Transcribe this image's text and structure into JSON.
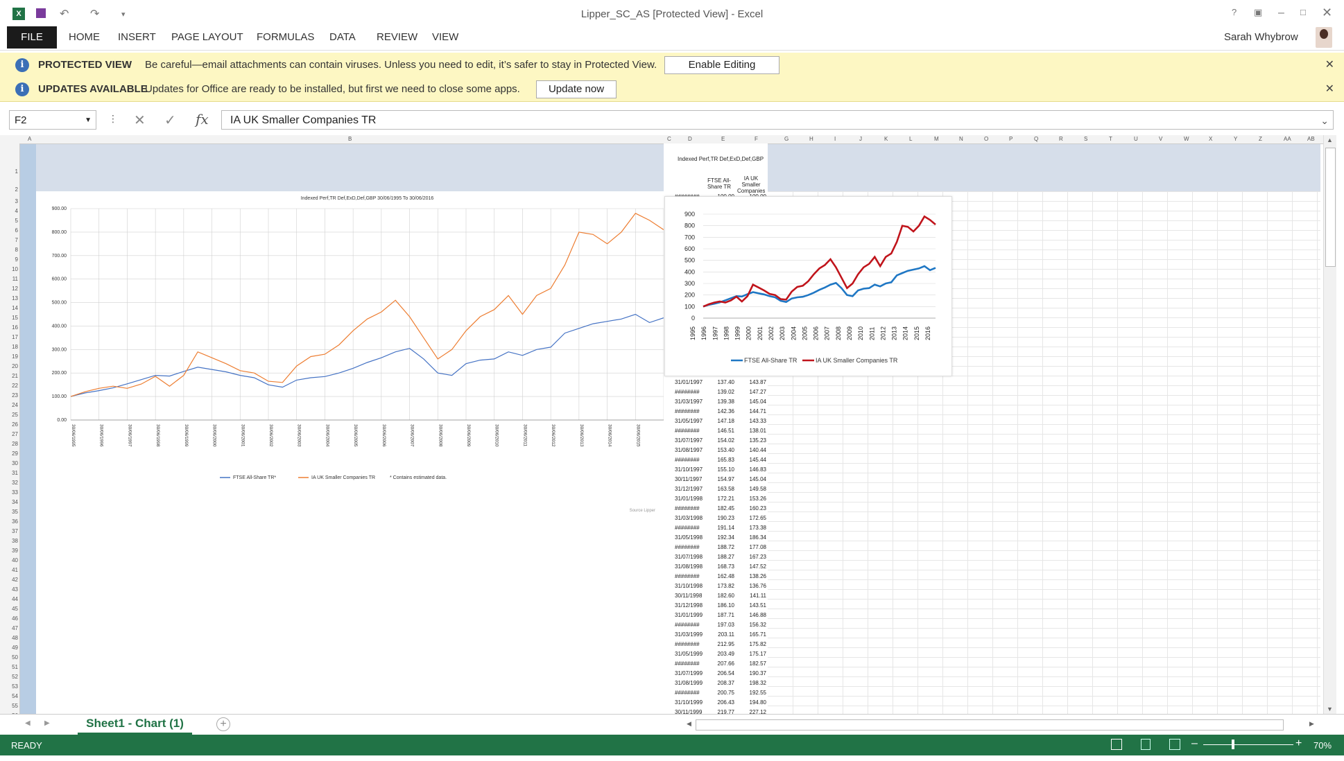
{
  "window": {
    "title": "Lipper_SC_AS  [Protected View] - Excel",
    "user": "Sarah Whybrow"
  },
  "ribbon": {
    "tabs": [
      "FILE",
      "HOME",
      "INSERT",
      "PAGE LAYOUT",
      "FORMULAS",
      "DATA",
      "REVIEW",
      "VIEW"
    ]
  },
  "protected_bar": {
    "title": "PROTECTED VIEW",
    "text": "Be careful—email attachments can contain viruses. Unless you need to edit, it’s safer to stay in Protected View.",
    "button": "Enable Editing"
  },
  "updates_bar": {
    "title": "UPDATES AVAILABLE",
    "text": "Updates for Office are ready to be installed, but first we need to close some apps.",
    "button": "Update now"
  },
  "formula_bar": {
    "name_box": "F2",
    "formula": "IA UK Smaller Companies TR"
  },
  "columns": [
    "A",
    "B",
    "C",
    "D",
    "E",
    "F",
    "G",
    "H",
    "I",
    "J",
    "K",
    "L",
    "M",
    "N",
    "O",
    "P",
    "Q",
    "R",
    "S",
    "T",
    "U",
    "V",
    "W",
    "X",
    "Y",
    "Z",
    "AA",
    "AB"
  ],
  "rows": [
    "1",
    "2",
    "3",
    "4",
    "5",
    "6",
    "7",
    "8",
    "9",
    "10",
    "11",
    "12",
    "13",
    "14",
    "15",
    "16",
    "17",
    "18",
    "19",
    "20",
    "21",
    "22",
    "23",
    "24",
    "25",
    "26",
    "27",
    "28",
    "29",
    "30",
    "31",
    "32",
    "33",
    "34",
    "35",
    "36",
    "37",
    "38",
    "39",
    "40",
    "41",
    "42",
    "43",
    "44",
    "45",
    "46",
    "47",
    "48",
    "49",
    "50",
    "51",
    "52",
    "53",
    "54",
    "55",
    "56"
  ],
  "table": {
    "heading": "Indexed Perf,TR Def,ExD,Def,GBP",
    "col_e": "FTSE All-Share TR",
    "col_f": "IA UK Smaller Companies",
    "first_row": {
      "date": "########",
      "e": "100.00",
      "f": "100.00"
    },
    "rows": [
      [
        "31/01/1997",
        "137.40",
        "143.87"
      ],
      [
        "########",
        "139.02",
        "147.27"
      ],
      [
        "31/03/1997",
        "139.38",
        "145.04"
      ],
      [
        "########",
        "142.36",
        "144.71"
      ],
      [
        "31/05/1997",
        "147.18",
        "143.33"
      ],
      [
        "########",
        "146.51",
        "138.01"
      ],
      [
        "31/07/1997",
        "154.02",
        "135.23"
      ],
      [
        "31/08/1997",
        "153.40",
        "140.44"
      ],
      [
        "########",
        "165.83",
        "145.44"
      ],
      [
        "31/10/1997",
        "155.10",
        "146.83"
      ],
      [
        "30/11/1997",
        "154.97",
        "145.04"
      ],
      [
        "31/12/1997",
        "163.58",
        "149.58"
      ],
      [
        "31/01/1998",
        "172.21",
        "153.26"
      ],
      [
        "########",
        "182.45",
        "160.23"
      ],
      [
        "31/03/1998",
        "190.23",
        "172.65"
      ],
      [
        "########",
        "191.14",
        "173.38"
      ],
      [
        "31/05/1998",
        "192.34",
        "186.34"
      ],
      [
        "########",
        "188.72",
        "177.08"
      ],
      [
        "31/07/1998",
        "188.27",
        "167.23"
      ],
      [
        "31/08/1998",
        "168.73",
        "147.52"
      ],
      [
        "########",
        "162.48",
        "138.26"
      ],
      [
        "31/10/1998",
        "173.82",
        "136.76"
      ],
      [
        "30/11/1998",
        "182.60",
        "141.11"
      ],
      [
        "31/12/1998",
        "186.10",
        "143.51"
      ],
      [
        "31/01/1999",
        "187.71",
        "146.88"
      ],
      [
        "########",
        "197.03",
        "156.32"
      ],
      [
        "31/03/1999",
        "203.11",
        "165.71"
      ],
      [
        "########",
        "212.95",
        "175.82"
      ],
      [
        "31/05/1999",
        "203.49",
        "175.17"
      ],
      [
        "########",
        "207.66",
        "182.57"
      ],
      [
        "31/07/1999",
        "206.54",
        "190.37"
      ],
      [
        "31/08/1999",
        "208.37",
        "198.32"
      ],
      [
        "########",
        "200.75",
        "192.55"
      ],
      [
        "31/10/1999",
        "206.43",
        "194.80"
      ],
      [
        "30/11/1999",
        "219.77",
        "227.12"
      ]
    ]
  },
  "chart_data": [
    {
      "type": "line",
      "title": "Indexed Perf,TR Def,ExD,Def,GBP 30/06/1995 To 30/06/2016",
      "yticks": [
        "900.00",
        "800.00",
        "700.00",
        "600.00",
        "500.00",
        "400.00",
        "300.00",
        "200.00",
        "100.00",
        "0.00"
      ],
      "ylim": [
        0,
        900
      ],
      "xticks": [
        "30/06/1995",
        "30/06/1996",
        "30/06/1997",
        "30/06/1998",
        "30/06/1999",
        "30/06/2000",
        "30/06/2001",
        "30/06/2002",
        "30/06/2003",
        "30/06/2004",
        "30/06/2005",
        "30/06/2006",
        "30/06/2007",
        "30/06/2008",
        "30/06/2009",
        "30/06/2010",
        "30/06/2011",
        "30/06/2012",
        "30/06/2013",
        "30/06/2014",
        "30/06/2015",
        "30/06/2016"
      ],
      "legend": [
        "FTSE All-Share TR*",
        "IA UK Smaller Companies TR"
      ],
      "note": "* Contains estimated data.",
      "source": "Source Lipper",
      "grid": true,
      "series": [
        {
          "name": "FTSE All-Share TR*",
          "color": "#4472c4",
          "x": [
            1995.5,
            1996,
            1996.5,
            1997,
            1997.5,
            1998,
            1998.5,
            1999,
            1999.5,
            2000,
            2000.5,
            2001,
            2001.5,
            2002,
            2002.5,
            2003,
            2003.5,
            2004,
            2004.5,
            2005,
            2005.5,
            2006,
            2006.5,
            2007,
            2007.5,
            2008,
            2008.5,
            2009,
            2009.5,
            2010,
            2010.5,
            2011,
            2011.5,
            2012,
            2012.5,
            2013,
            2013.5,
            2014,
            2014.5,
            2015,
            2015.5,
            2016,
            2016.5
          ],
          "y": [
            100,
            115,
            125,
            137,
            154,
            172,
            190,
            187,
            207,
            225,
            215,
            205,
            190,
            180,
            150,
            140,
            170,
            180,
            185,
            200,
            220,
            245,
            265,
            290,
            305,
            260,
            200,
            190,
            240,
            255,
            260,
            290,
            275,
            300,
            310,
            370,
            390,
            410,
            420,
            430,
            450,
            415,
            435
          ]
        },
        {
          "name": "IA UK Smaller Companies TR",
          "color": "#ed7d31",
          "x": [
            1995.5,
            1996,
            1996.5,
            1997,
            1997.5,
            1998,
            1998.5,
            1999,
            1999.5,
            2000,
            2000.5,
            2001,
            2001.5,
            2002,
            2002.5,
            2003,
            2003.5,
            2004,
            2004.5,
            2005,
            2005.5,
            2006,
            2006.5,
            2007,
            2007.5,
            2008,
            2008.5,
            2009,
            2009.5,
            2010,
            2010.5,
            2011,
            2011.5,
            2012,
            2012.5,
            2013,
            2013.5,
            2014,
            2014.5,
            2015,
            2015.5,
            2016,
            2016.5
          ],
          "y": [
            100,
            120,
            135,
            144,
            135,
            153,
            186,
            144,
            190,
            290,
            265,
            240,
            210,
            200,
            165,
            160,
            230,
            270,
            280,
            320,
            380,
            430,
            460,
            510,
            440,
            350,
            260,
            300,
            380,
            440,
            470,
            530,
            450,
            530,
            560,
            660,
            800,
            790,
            750,
            800,
            880,
            850,
            810
          ]
        }
      ]
    },
    {
      "type": "line",
      "title": "",
      "yticks": [
        "900",
        "800",
        "700",
        "600",
        "500",
        "400",
        "300",
        "200",
        "100",
        "0"
      ],
      "ylim": [
        0,
        900
      ],
      "xticks": [
        "1995",
        "1996",
        "1997",
        "1998",
        "1999",
        "2000",
        "2001",
        "2002",
        "2003",
        "2004",
        "2005",
        "2006",
        "2007",
        "2008",
        "2009",
        "2010",
        "2011",
        "2012",
        "2013",
        "2014",
        "2015",
        "2016"
      ],
      "legend": [
        "FTSE All-Share TR",
        "IA UK Smaller Companies TR"
      ],
      "series": [
        {
          "name": "FTSE All-Share TR",
          "color": "#1f77c4"
        },
        {
          "name": "IA UK Smaller Companies TR",
          "color": "#c0141b"
        }
      ]
    }
  ],
  "sheet": {
    "tab": "Sheet1 - Chart (1)"
  },
  "status": {
    "mode": "READY",
    "zoom": "70%"
  }
}
